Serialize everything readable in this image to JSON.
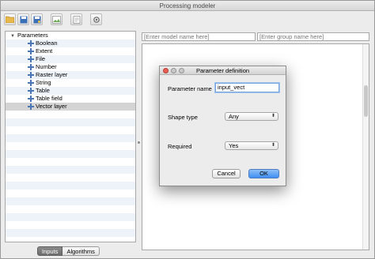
{
  "window": {
    "title": "Processing modeler"
  },
  "toolbar": {
    "icons": [
      "open-folder-icon",
      "save-icon",
      "save-as-icon",
      "export-image-icon",
      "edit-help-icon",
      "run-icon"
    ]
  },
  "tree": {
    "root_label": "Parameters",
    "items": [
      {
        "label": "Boolean"
      },
      {
        "label": "Extent"
      },
      {
        "label": "File"
      },
      {
        "label": "Number"
      },
      {
        "label": "Raster layer"
      },
      {
        "label": "String"
      },
      {
        "label": "Table"
      },
      {
        "label": "Table field"
      },
      {
        "label": "Vector layer",
        "selected": true
      }
    ]
  },
  "tabs": {
    "inputs": "Inputs",
    "algorithms": "Algorithms"
  },
  "model": {
    "name_placeholder": "[Enter model name here]",
    "group_placeholder": "[Enter group name here]"
  },
  "dialog": {
    "title": "Parameter definition",
    "param_name_label": "Parameter name",
    "param_name_value": "input_vect",
    "shape_type_label": "Shape type",
    "shape_type_value": "Any",
    "required_label": "Required",
    "required_value": "Yes",
    "cancel_label": "Cancel",
    "ok_label": "OK"
  },
  "colors": {
    "accent": "#3f8ef2",
    "selected_row": "#d4d4d4",
    "close_button": "#ee5b53"
  }
}
